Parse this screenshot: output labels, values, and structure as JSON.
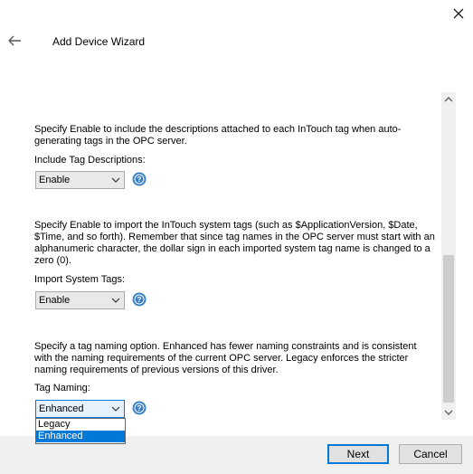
{
  "window": {
    "title": "Add Device Wizard"
  },
  "section_descriptions": {
    "text_1": "Specify Enable to include the descriptions attached to each InTouch tag when auto-generating tags in the OPC server.",
    "label": "Include Tag Descriptions:",
    "value": "Enable"
  },
  "section_system_tags": {
    "text_1": "Specify Enable to import the InTouch system tags (such as $ApplicationVersion, $Date, $Time, and so forth). Remember that since tag names in the OPC server must start with an alphanumeric character, the dollar sign in each imported system tag name is changed to a zero (0).",
    "label": "Import System Tags:",
    "value": "Enable"
  },
  "section_naming": {
    "text_1": "Specify a tag naming option. Enhanced has fewer naming constraints and is consistent with the naming requirements of the current OPC server. Legacy enforces the stricter naming requirements of previous versions of this driver.",
    "label": "Tag Naming:",
    "value": "Enhanced",
    "options": [
      "Legacy",
      "Enhanced"
    ],
    "selected_index": 1
  },
  "buttons": {
    "next": "Next",
    "cancel": "Cancel"
  },
  "colors": {
    "accent": "#0078d7",
    "help_icon": "#3b7fc4",
    "footer_bg": "#f0f0f0"
  }
}
